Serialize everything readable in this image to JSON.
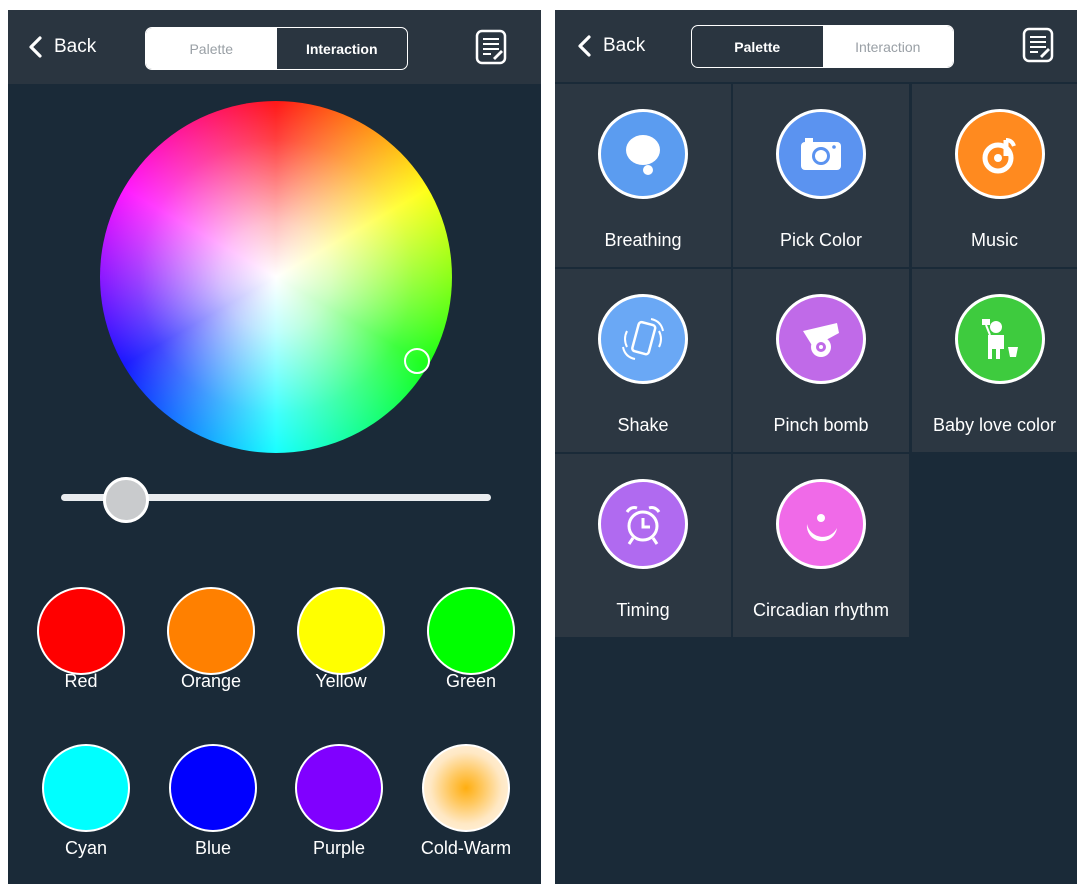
{
  "left_screen": {
    "back_label": "Back",
    "tabs": [
      {
        "label": "Palette",
        "active": false
      },
      {
        "label": "Interaction",
        "active": true
      }
    ],
    "brightness_percent": 15,
    "presets": [
      {
        "label": "Red",
        "color": "#ff0000"
      },
      {
        "label": "Orange",
        "color": "#ff8000"
      },
      {
        "label": "Yellow",
        "color": "#ffff00"
      },
      {
        "label": "Green",
        "color": "#00ff00"
      },
      {
        "label": "Cyan",
        "color": "#00ffff"
      },
      {
        "label": "Blue",
        "color": "#0000ff"
      },
      {
        "label": "Purple",
        "color": "#8000ff"
      },
      {
        "label": "Cold-Warm",
        "color": "#ffb020"
      }
    ]
  },
  "right_screen": {
    "back_label": "Back",
    "tabs": [
      {
        "label": "Palette",
        "active": true
      },
      {
        "label": "Interaction",
        "active": false
      }
    ],
    "modes": [
      {
        "label": "Breathing",
        "icon": "bubble-icon",
        "color": "#5b9cf0"
      },
      {
        "label": "Pick Color",
        "icon": "camera-icon",
        "color": "#5b93f0"
      },
      {
        "label": "Music",
        "icon": "music-note-icon",
        "color": "#ff8a1f"
      },
      {
        "label": "Shake",
        "icon": "shake-phone-icon",
        "color": "#6aa8f5"
      },
      {
        "label": "Pinch bomb",
        "icon": "cannon-icon",
        "color": "#c06ae8"
      },
      {
        "label": "Baby love color",
        "icon": "child-painting-icon",
        "color": "#3ecb3e"
      },
      {
        "label": "Timing",
        "icon": "alarm-clock-icon",
        "color": "#b06af0"
      },
      {
        "label": "Circadian rhythm",
        "icon": "moon-icon",
        "color": "#f06ae8"
      }
    ]
  }
}
